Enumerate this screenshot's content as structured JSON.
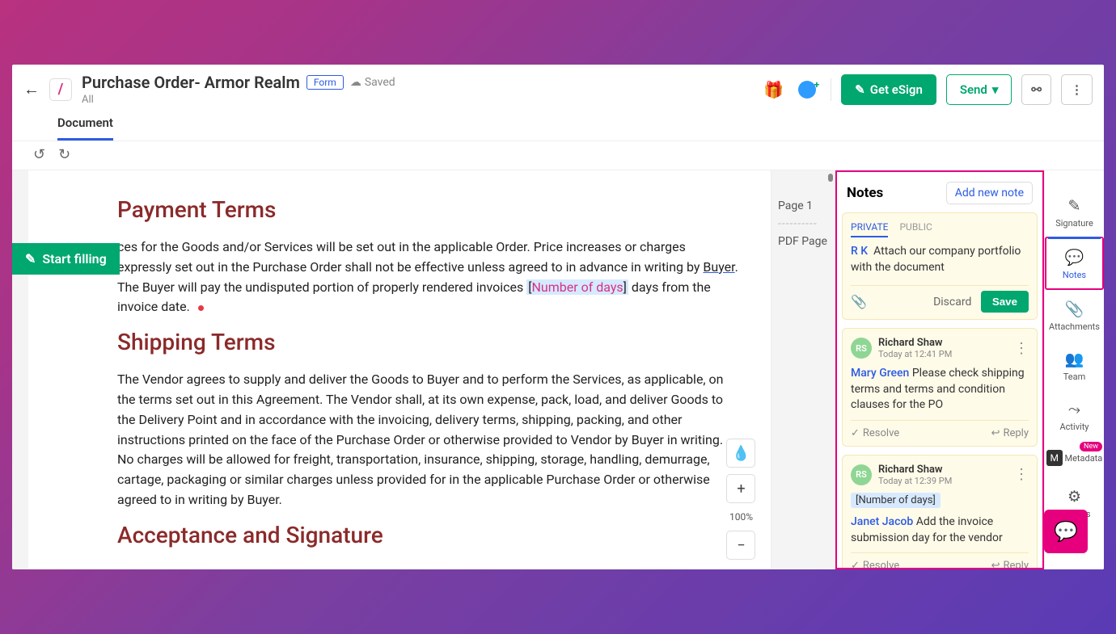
{
  "header": {
    "title": "Purchase Order- Armor Realm",
    "badge": "Form",
    "saved": "Saved",
    "subtitle": "All",
    "get_esign": "Get eSign",
    "send": "Send"
  },
  "tabs": {
    "document": "Document"
  },
  "start_filling": "Start filling",
  "sections": {
    "payment_title": "Payment Terms",
    "payment_body_1": "ces for the Goods and/or Services will be set out in the applicable Order. Price increases or charges",
    "payment_body_2": " expressly set out in the Purchase Order shall not be effective unless agreed to in advance in writing by ",
    "buyer": "Buyer",
    "payment_body_3": ". The Buyer will pay the undisputed portion of properly rendered invoices ",
    "num_days_bracket_open": "[",
    "num_days": "Number of days",
    "num_days_bracket_close": "]",
    "payment_body_4": " days from the invoice date.",
    "shipping_title": "Shipping Terms",
    "shipping_body": "The Vendor agrees to supply and deliver the Goods to Buyer and to perform the Services, as applicable, on the terms set out in this Agreement. The Vendor shall, at its own expense, pack, load, and deliver Goods to the Delivery Point and in accordance with the invoicing, delivery terms, shipping, packing, and other instructions printed on the face of the Purchase Order or otherwise provided to Vendor by Buyer in writing. No charges will be allowed for freight, transportation, insurance, shipping, storage, handling, demurrage, cartage, packaging or similar charges unless provided for in the applicable Purchase Order or otherwise agreed to in writing by Buyer.",
    "acceptance_title": "Acceptance and Signature"
  },
  "page_nav": {
    "page1": "Page 1",
    "pdfpage": "PDF Page"
  },
  "zoom": {
    "pct": "100%"
  },
  "notes": {
    "title": "Notes",
    "add": "Add new note",
    "tabs": {
      "private": "PRIVATE",
      "public": "PUBLIC"
    },
    "compose": {
      "author": "R K",
      "text": "Attach our company portfolio with the document",
      "discard": "Discard",
      "save": "Save"
    },
    "n1": {
      "avatar": "RS",
      "name": "Richard Shaw",
      "time": "Today at 12:41 PM",
      "mention": "Mary Green",
      "text": " Please check shipping terms and terms and condition clauses for the PO",
      "resolve": "Resolve",
      "reply": "Reply"
    },
    "n2": {
      "avatar": "RS",
      "name": "Richard Shaw",
      "time": "Today at 12:39 PM",
      "ref": "[Number of days]",
      "mention": "Janet Jacob",
      "text": " Add the invoice submission day for the vendor",
      "resolve": "Resolve",
      "reply": "Reply"
    }
  },
  "rail": {
    "signature": "Signature",
    "notes": "Notes",
    "attachments": "Attachments",
    "team": "Team",
    "activity": "Activity",
    "metadata": "Metadata",
    "metadata_badge": "New",
    "settings": "Settings"
  }
}
